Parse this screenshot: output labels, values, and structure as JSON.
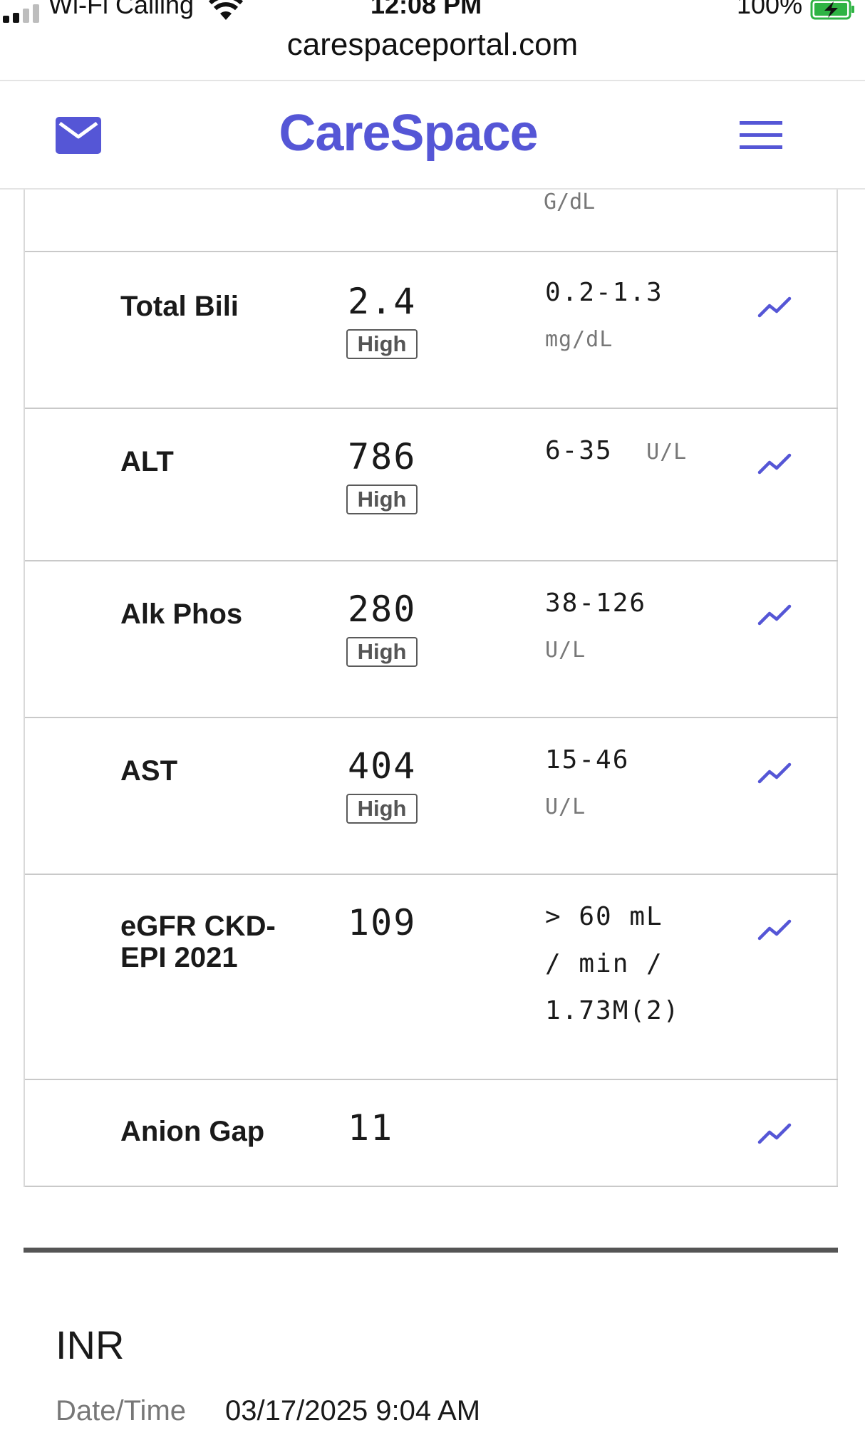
{
  "status_bar": {
    "carrier": "Wi-Fi Calling",
    "time": "12:08 PM",
    "battery": "100%"
  },
  "browser": {
    "url": "carespaceportal.com"
  },
  "header": {
    "brand": "CareSpace",
    "accent_color": "#5556d6",
    "icons": [
      "mail-icon",
      "hamburger-menu-icon"
    ]
  },
  "labs": {
    "partial_prev_unit": "G/dL",
    "rows": [
      {
        "name": "Total Bili",
        "value": "2.4",
        "flag": "High",
        "range": "0.2-1.3",
        "unit": "mg/dL"
      },
      {
        "name": "ALT",
        "value": "786",
        "flag": "High",
        "range": "6-35",
        "unit": "U/L"
      },
      {
        "name": "Alk Phos",
        "value": "280",
        "flag": "High",
        "range": "38-126",
        "unit": "U/L"
      },
      {
        "name": "AST",
        "value": "404",
        "flag": "High",
        "range": "15-46",
        "unit": "U/L"
      },
      {
        "name": "eGFR CKD-EPI 2021",
        "value": "109",
        "flag": "",
        "range": "> 60 mL / min / 1.73M(2)",
        "unit": "",
        "range_lines": [
          "> 60 mL",
          "/ min /",
          "1.73M(2)"
        ]
      },
      {
        "name": "Anion Gap",
        "value": "11",
        "flag": "",
        "range": "",
        "unit": ""
      }
    ]
  },
  "inr": {
    "title": "INR",
    "datetime_label": "Date/Time",
    "datetime_value": "03/17/2025 9:04 AM"
  }
}
